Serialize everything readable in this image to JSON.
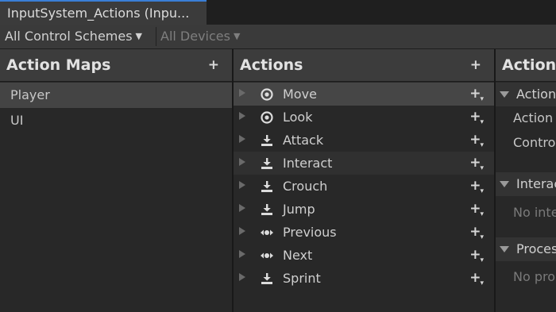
{
  "window": {
    "tab_title": "InputSystem_Actions (Inpu..."
  },
  "toolbar": {
    "control_schemes": "All Control Schemes",
    "devices": "All Devices"
  },
  "action_maps": {
    "title": "Action Maps",
    "add": "+",
    "items": [
      {
        "label": "Player",
        "selected": true
      },
      {
        "label": "UI",
        "selected": false
      }
    ]
  },
  "actions": {
    "title": "Actions",
    "add": "+",
    "items": [
      {
        "label": "Move",
        "icon": "value-icon",
        "selected": true
      },
      {
        "label": "Look",
        "icon": "value-icon"
      },
      {
        "label": "Attack",
        "icon": "button-icon"
      },
      {
        "label": "Interact",
        "icon": "button-icon",
        "hover": true
      },
      {
        "label": "Crouch",
        "icon": "button-icon"
      },
      {
        "label": "Jump",
        "icon": "button-icon"
      },
      {
        "label": "Previous",
        "icon": "passthrough-icon"
      },
      {
        "label": "Next",
        "icon": "passthrough-icon"
      },
      {
        "label": "Sprint",
        "icon": "button-icon"
      }
    ]
  },
  "properties": {
    "title": "Action",
    "section_action": "Action",
    "action_type_label": "Action",
    "control_type_label": "Contro",
    "section_interactions": "Interac",
    "no_interactions": "No inte",
    "section_processors": "Proces",
    "no_processors": "No pro"
  },
  "colors": {
    "accent": "#3a7ed6",
    "panel_bg": "#282828",
    "header_bg": "#3c3c3c",
    "selected_row": "#464646"
  }
}
